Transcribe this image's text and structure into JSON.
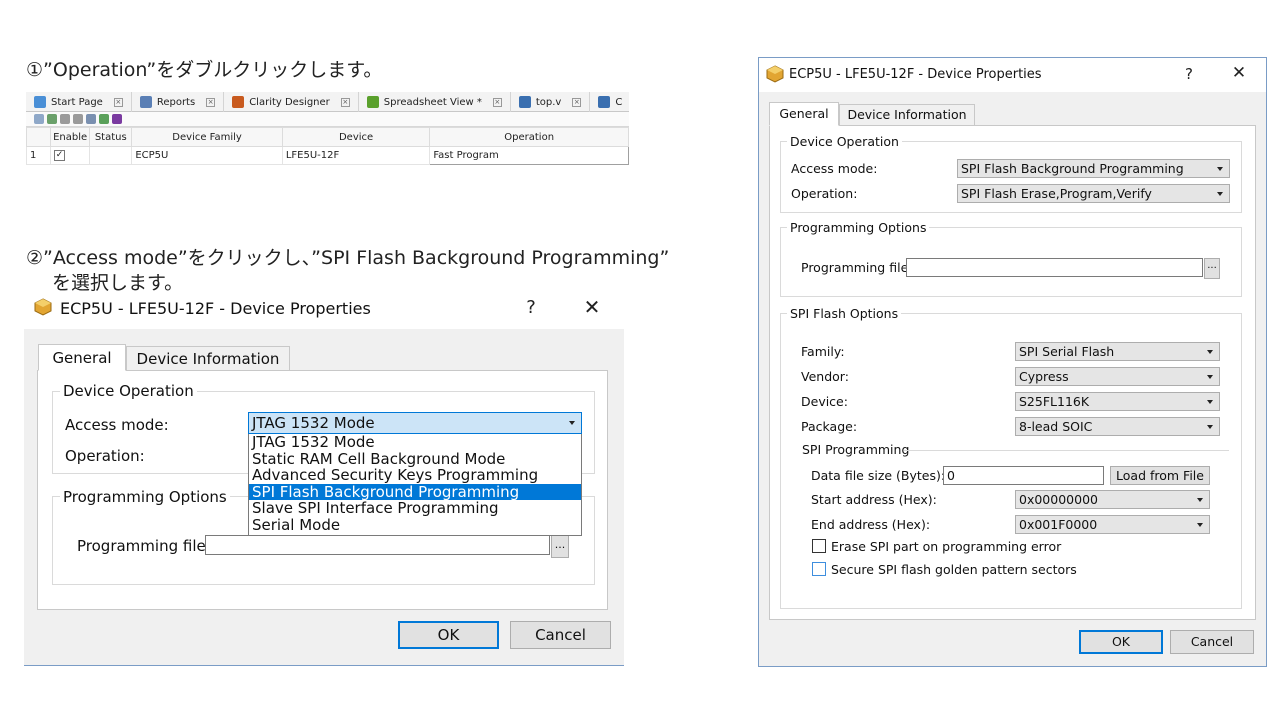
{
  "steps": {
    "step1": "①”Operation”をダブルクリックします。",
    "step2_line1": "②”Access mode”をクリックし、”SPI Flash Background Programming”",
    "step2_line2": "を選択します。"
  },
  "top_panel": {
    "tabs": [
      {
        "label": "Start Page",
        "icon": "start-page-icon",
        "color": "#4a8fd6"
      },
      {
        "label": "Reports",
        "icon": "reports-icon",
        "color": "#5a7fb5"
      },
      {
        "label": "Clarity Designer",
        "icon": "clarity-designer-icon",
        "color": "#c85a1e"
      },
      {
        "label": "Spreadsheet View *",
        "icon": "spreadsheet-view-icon",
        "color": "#5aa02c"
      },
      {
        "label": "top.v",
        "icon": "file-edit-icon",
        "color": "#3a6fb0"
      },
      {
        "label": "C",
        "icon": "file-edit-icon",
        "color": "#3a6fb0"
      }
    ],
    "table": {
      "headers": [
        "Enable",
        "Status",
        "Device Family",
        "Device",
        "Operation"
      ],
      "row": {
        "index": "1",
        "enabled_mark": "✓",
        "status": "",
        "family": "ECP5U",
        "device": "LFE5U-12F",
        "operation": "Fast Program"
      }
    }
  },
  "dialog_a": {
    "title": "ECP5U - LFE5U-12F - Device Properties",
    "help": "?",
    "close": "✕",
    "tabs": {
      "general": "General",
      "device_info": "Device Information"
    },
    "device_operation": {
      "group": "Device Operation",
      "access_mode_label": "Access mode:",
      "access_mode_value": "JTAG 1532 Mode",
      "operation_label": "Operation:"
    },
    "dropdown_options": [
      "JTAG 1532 Mode",
      "Static RAM Cell Background Mode",
      "Advanced Security Keys Programming",
      "SPI Flash Background Programming",
      "Slave SPI Interface Programming",
      "Serial Mode"
    ],
    "selected_option": "SPI Flash Background Programming",
    "programming_options": {
      "group": "Programming Options",
      "file_label": "Programming file:",
      "file_value": "",
      "browse": "..."
    },
    "buttons": {
      "ok": "OK",
      "cancel": "Cancel"
    }
  },
  "dialog_b": {
    "title": "ECP5U - LFE5U-12F - Device Properties",
    "help": "?",
    "close": "✕",
    "tabs": {
      "general": "General",
      "device_info": "Device Information"
    },
    "device_operation": {
      "group": "Device Operation",
      "access_mode_label": "Access mode:",
      "access_mode_value": "SPI Flash Background Programming",
      "operation_label": "Operation:",
      "operation_value": "SPI Flash Erase,Program,Verify"
    },
    "programming_options": {
      "group": "Programming Options",
      "file_label": "Programming file:",
      "file_value": "",
      "browse": "..."
    },
    "spi_flash_options": {
      "group": "SPI Flash Options",
      "family_label": "Family:",
      "family_value": "SPI Serial Flash",
      "vendor_label": "Vendor:",
      "vendor_value": "Cypress",
      "device_label": "Device:",
      "device_value": "S25FL116K",
      "package_label": "Package:",
      "package_value": "8-lead SOIC",
      "spi_programming": "SPI Programming",
      "data_size_label": "Data file size (Bytes):",
      "data_size_value": "0",
      "load_button": "Load from File",
      "start_label": "Start address (Hex):",
      "start_value": "0x00000000",
      "end_label": "End address (Hex):",
      "end_value": "0x001F0000",
      "erase_label": "Erase SPI part on programming error",
      "secure_label": "Secure SPI flash golden pattern sectors"
    },
    "buttons": {
      "ok": "OK",
      "cancel": "Cancel"
    }
  },
  "colors": {
    "selection": "#0078d7",
    "dialog_bg": "#f0f0f0",
    "accent_border": "#0078d7"
  }
}
